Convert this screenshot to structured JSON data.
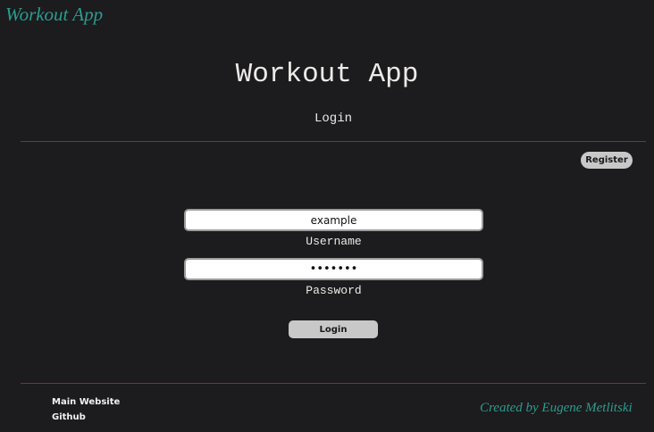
{
  "brand": {
    "name": "Workout App"
  },
  "header": {
    "title": "Workout App",
    "subtitle": "Login"
  },
  "actions": {
    "register_label": "Register",
    "login_label": "Login"
  },
  "form": {
    "username": {
      "value": "example",
      "label": "Username"
    },
    "password": {
      "value": "1234567",
      "label": "Password"
    }
  },
  "footer": {
    "links": [
      "Main Website",
      "Github"
    ],
    "credit": "Created by Eugene Metlitski"
  },
  "colors": {
    "background": "#1c1b1d",
    "accent": "#2a9d8f",
    "divider": "#8a2840",
    "button": "#c8c8c8"
  }
}
